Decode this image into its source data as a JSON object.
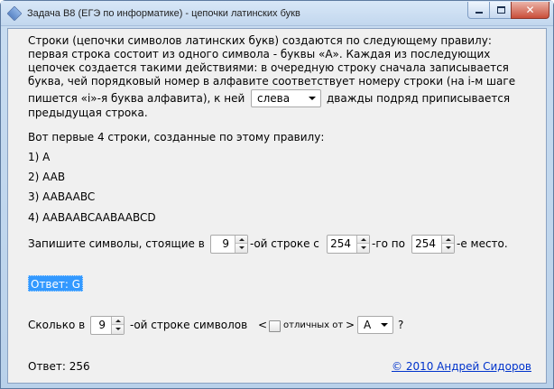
{
  "window": {
    "title": "Задача B8 (ЕГЭ по информатике) - цепочки латинских букв"
  },
  "problem": {
    "line1": "Строки (цепочки символов латинских букв)  создаются по следующему правилу:",
    "line2": "первая строка состоит из одного символа - буквы «А». Каждая из последующих",
    "line3": "цепочек создается такими действиями: в очередную строку сначала записывается",
    "line4": "буква, чей порядковый номер в алфавите соответствует номеру строки (на i-м шаге",
    "line5a": "пишется «i»-я буква алфавита), к ней",
    "line5b": "дважды подряд приписывается",
    "line6": "предыдущая строка.",
    "direction_value": "слева"
  },
  "examples": {
    "intro": "Вот первые 4 строки, созданные по этому правилу:",
    "items": [
      "1) A",
      "2) AAB",
      "3) AABAABC",
      "4) AABAABCAABAABCD"
    ]
  },
  "query1": {
    "prefix": "Запишите символы, стоящие в",
    "row_value": "9",
    "middle1": "-ой строке с",
    "from_value": "254",
    "middle2": "-го по",
    "to_value": "254",
    "suffix": "-е место."
  },
  "answer1": {
    "text": "Ответ: G"
  },
  "query2": {
    "prefix": "Сколько в",
    "row_value": "9",
    "middle": "-ой строке символов",
    "open_bracket": "<",
    "checkbox_label": "отличных от",
    "close_bracket": ">",
    "letter_value": "A",
    "question_mark": "?"
  },
  "answer2": {
    "text": "Ответ: 256"
  },
  "footer": {
    "copyright": "© 2010 Андрей Сидоров"
  }
}
